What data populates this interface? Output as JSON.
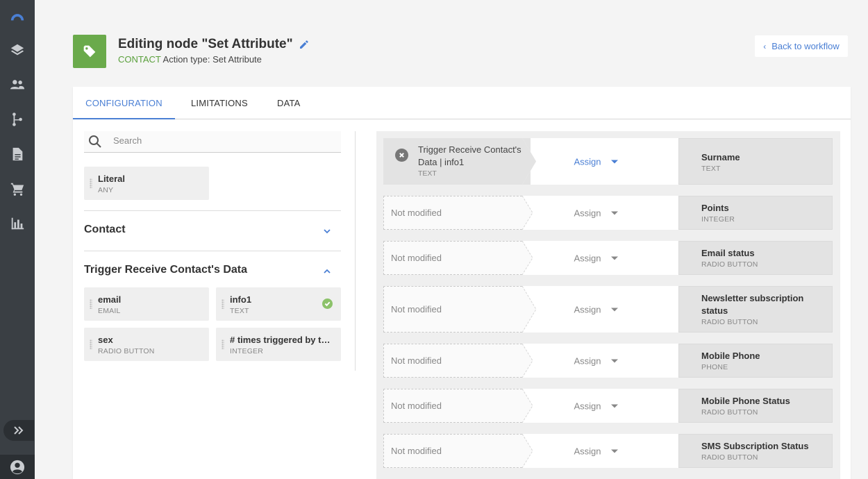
{
  "header": {
    "title": "Editing node \"Set Attribute\"",
    "subtitle_tag": "CONTACT",
    "subtitle_rest": " Action type: Set Attribute",
    "back_label": "Back to workflow"
  },
  "tabs": [
    {
      "label": "CONFIGURATION",
      "active": true
    },
    {
      "label": "LIMITATIONS",
      "active": false
    },
    {
      "label": "DATA",
      "active": false
    }
  ],
  "search": {
    "placeholder": "Search"
  },
  "literal_chip": {
    "name": "Literal",
    "type": "ANY"
  },
  "sections": [
    {
      "title": "Contact",
      "expanded": false
    },
    {
      "title": "Trigger Receive Contact's Data",
      "expanded": true
    }
  ],
  "trigger_fields": [
    {
      "name": "email",
      "type": "EMAIL",
      "selected": false
    },
    {
      "name": "info1",
      "type": "TEXT",
      "selected": true
    },
    {
      "name": "sex",
      "type": "RADIO BUTTON",
      "selected": false
    },
    {
      "name": "# times triggered by th...",
      "type": "INTEGER",
      "selected": false
    }
  ],
  "mappings": [
    {
      "source": "Trigger Receive Contact's Data | info1",
      "source_type": "TEXT",
      "operation": "Assign",
      "target": "Surname",
      "target_type": "TEXT",
      "modified": true
    },
    {
      "source": "Not modified",
      "source_type": "",
      "operation": "Assign",
      "target": "Points",
      "target_type": "INTEGER",
      "modified": false
    },
    {
      "source": "Not modified",
      "source_type": "",
      "operation": "Assign",
      "target": "Email status",
      "target_type": "RADIO BUTTON",
      "modified": false
    },
    {
      "source": "Not modified",
      "source_type": "",
      "operation": "Assign",
      "target": "Newsletter subscription status",
      "target_type": "RADIO BUTTON",
      "modified": false
    },
    {
      "source": "Not modified",
      "source_type": "",
      "operation": "Assign",
      "target": "Mobile Phone",
      "target_type": "PHONE",
      "modified": false
    },
    {
      "source": "Not modified",
      "source_type": "",
      "operation": "Assign",
      "target": "Mobile Phone Status",
      "target_type": "RADIO BUTTON",
      "modified": false
    },
    {
      "source": "Not modified",
      "source_type": "",
      "operation": "Assign",
      "target": "SMS Subscription Status",
      "target_type": "RADIO BUTTON",
      "modified": false
    }
  ],
  "colors": {
    "accent": "#4a7fd4",
    "success": "#6aaa4b",
    "sidebar": "#3a3f44"
  }
}
